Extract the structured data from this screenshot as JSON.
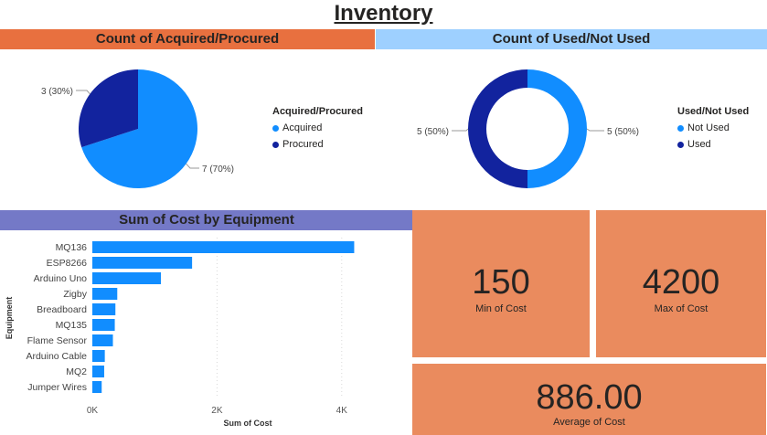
{
  "page": {
    "title": "Inventory"
  },
  "headers": {
    "acquired": "Count of Acquired/Procured",
    "used": "Count of Used/Not Used",
    "cost": "Sum of Cost by Equipment"
  },
  "acquired_legend": {
    "title": "Acquired/Procured",
    "items": [
      {
        "label": "Acquired",
        "color": "#118dff"
      },
      {
        "label": "Procured",
        "color": "#12239e"
      }
    ]
  },
  "used_legend": {
    "title": "Used/Not Used",
    "items": [
      {
        "label": "Not Used",
        "color": "#118dff"
      },
      {
        "label": "Used",
        "color": "#12239e"
      }
    ]
  },
  "cards": {
    "min": {
      "value": "150",
      "label": "Min of Cost"
    },
    "max": {
      "value": "4200",
      "label": "Max of Cost"
    },
    "avg": {
      "value": "886.00",
      "label": "Average of Cost"
    }
  },
  "colors": {
    "accent_orange": "#e8703f",
    "card": "#ea8b5e",
    "light_blue": "#9ed0ff",
    "purple": "#7479c7",
    "blue": "#118dff",
    "navy": "#12239e"
  },
  "chart_data": [
    {
      "type": "pie",
      "title": "Count of Acquired/Procured",
      "categories": [
        "Acquired",
        "Procured"
      ],
      "values": [
        7,
        3
      ],
      "data_labels": [
        "7 (70%)",
        "3 (30%)"
      ],
      "legend": "right"
    },
    {
      "type": "pie",
      "subtype": "donut",
      "title": "Count of Used/Not Used",
      "categories": [
        "Not Used",
        "Used"
      ],
      "values": [
        5,
        5
      ],
      "data_labels": [
        "5 (50%)",
        "5 (50%)"
      ],
      "legend": "right"
    },
    {
      "type": "bar",
      "orientation": "horizontal",
      "title": "Sum of Cost by Equipment",
      "categories": [
        "MQ136",
        "ESP8266",
        "Arduino Uno",
        "Zigby",
        "Breadboard",
        "MQ135",
        "Flame Sensor",
        "Arduino Cable",
        "MQ2",
        "Jumper Wires"
      ],
      "values": [
        4200,
        1600,
        1100,
        400,
        370,
        360,
        330,
        200,
        190,
        150
      ],
      "xlabel": "Sum of Cost",
      "ylabel": "Equipment",
      "xticks": [
        "0K",
        "2K",
        "4K"
      ],
      "xlim": [
        0,
        4400
      ],
      "grid": "vertical"
    }
  ]
}
